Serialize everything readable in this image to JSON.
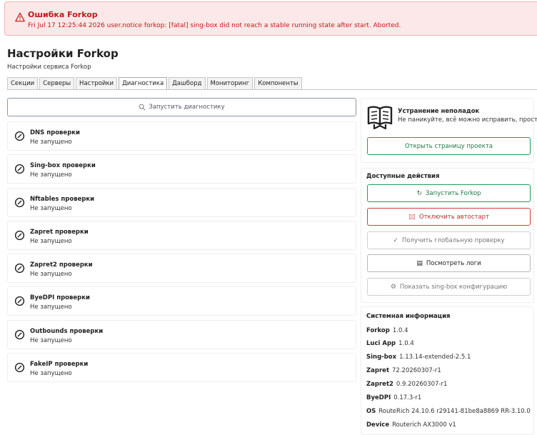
{
  "alert": {
    "title": "Ошибка Forkop",
    "message": "Fri Jul 17 12:25:44 2026 user.notice forkop: [fatal] sing-box did not reach a stable running state after start. Aborted."
  },
  "page": {
    "title": "Настройки Forkop",
    "subtitle": "Настройки сервиса Forkop"
  },
  "tabs": [
    {
      "label": "Секции"
    },
    {
      "label": "Серверы"
    },
    {
      "label": "Настройки"
    },
    {
      "label": "Диагностика",
      "active": true
    },
    {
      "label": "Дашборд"
    },
    {
      "label": "Мониторинг"
    },
    {
      "label": "Компоненты"
    }
  ],
  "diagnostics": {
    "run_label": "Запустить диагностику",
    "checks": [
      {
        "title": "DNS проверки",
        "status": "Не запущено"
      },
      {
        "title": "Sing-box проверки",
        "status": "Не запущено"
      },
      {
        "title": "Nftables проверки",
        "status": "Не запущено"
      },
      {
        "title": "Zapret проверки",
        "status": "Не запущено"
      },
      {
        "title": "Zapret2 проверки",
        "status": "Не запущено"
      },
      {
        "title": "ByeDPI проверки",
        "status": "Не запущено"
      },
      {
        "title": "Outbounds проверки",
        "status": "Не запущено"
      },
      {
        "title": "FakeIP проверки",
        "status": "Не запущено"
      }
    ]
  },
  "troubleshoot": {
    "title": "Устранение неполадок",
    "text": "Не паникуйте, всё можно исправить, просто...",
    "button": "Открыть страницу проекта"
  },
  "actions": {
    "title": "Доступные действия",
    "start": "Запустить Forkop",
    "disable_autostart": "Отключить автостарт",
    "global_check": "Получить глобальную проверку",
    "view_logs": "Посмотреть логи",
    "show_config": "Показать sing-box конфигурацию"
  },
  "sysinfo": {
    "title": "Системная информация",
    "rows": [
      {
        "label": "Forkop",
        "value": "1.0.4"
      },
      {
        "label": "Luci App",
        "value": "1.0.4"
      },
      {
        "label": "Sing-box",
        "value": "1.13.14-extended-2.5.1"
      },
      {
        "label": "Zapret",
        "value": "72.20260307-r1"
      },
      {
        "label": "Zapret2",
        "value": "0.9.20260307-r1"
      },
      {
        "label": "ByeDPI",
        "value": "0.17.3-r1"
      },
      {
        "label": "OS",
        "value": "RouteRich 24.10.6 r29141-81be8a8869 RR-3.10.0"
      },
      {
        "label": "Device",
        "value": "Routerich AX3000 v1"
      }
    ]
  },
  "colors": {
    "alert_bg": "#fce8e8",
    "alert_text": "#c0181c",
    "success": "#1f9d57",
    "danger": "#d83a3a"
  }
}
